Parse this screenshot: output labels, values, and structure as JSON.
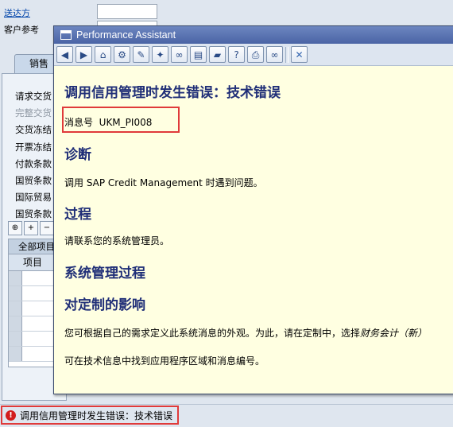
{
  "background": {
    "labels": [
      "送达方",
      "客户参考"
    ],
    "tab_sales": "销售",
    "panel_rows": [
      "请求交货",
      "完整交货",
      "交货冻结",
      "开票冻结",
      "付款条款",
      "国贸条款",
      "国际贸易",
      "国贸条款"
    ],
    "table_header": "全部项目",
    "table_col_item": "项目"
  },
  "status": {
    "text": "调用信用管理时发生错误：技术错误",
    "icon": "error-icon"
  },
  "popup": {
    "title": "Performance Assistant",
    "toolbar_icons": [
      "back-icon",
      "forward-icon",
      "home-icon",
      "technical-info-icon",
      "edit-icon",
      "wand-icon",
      "link-icon",
      "book-icon",
      "bookmark-icon",
      "help-icon",
      "print-icon",
      "binoculars-icon",
      "close-icon"
    ],
    "heading": "调用信用管理时发生错误：技术错误",
    "message_label": "消息号",
    "message_number": "UKM_PI008",
    "diagnosis_title": "诊断",
    "diagnosis_text": "调用  SAP Credit Management 时遇到问题。",
    "procedure_title": "过程",
    "procedure_text": "请联系您的系统管理员。",
    "sysadmin_title": "系统管理过程",
    "custom_title": "对定制的影响",
    "custom_text_1": "您可根据自己的需求定义此系统消息的外观。为此，请在定制中，选择",
    "custom_text_1_em": "财务会计（新）",
    "custom_text_2": "可在技术信息中找到应用程序区域和消息编号。"
  },
  "colors": {
    "heading": "#1f2e77",
    "highlight_border": "#e03a3a",
    "popup_bg": "#ffffe1",
    "titlebar": "#4a64a5"
  }
}
